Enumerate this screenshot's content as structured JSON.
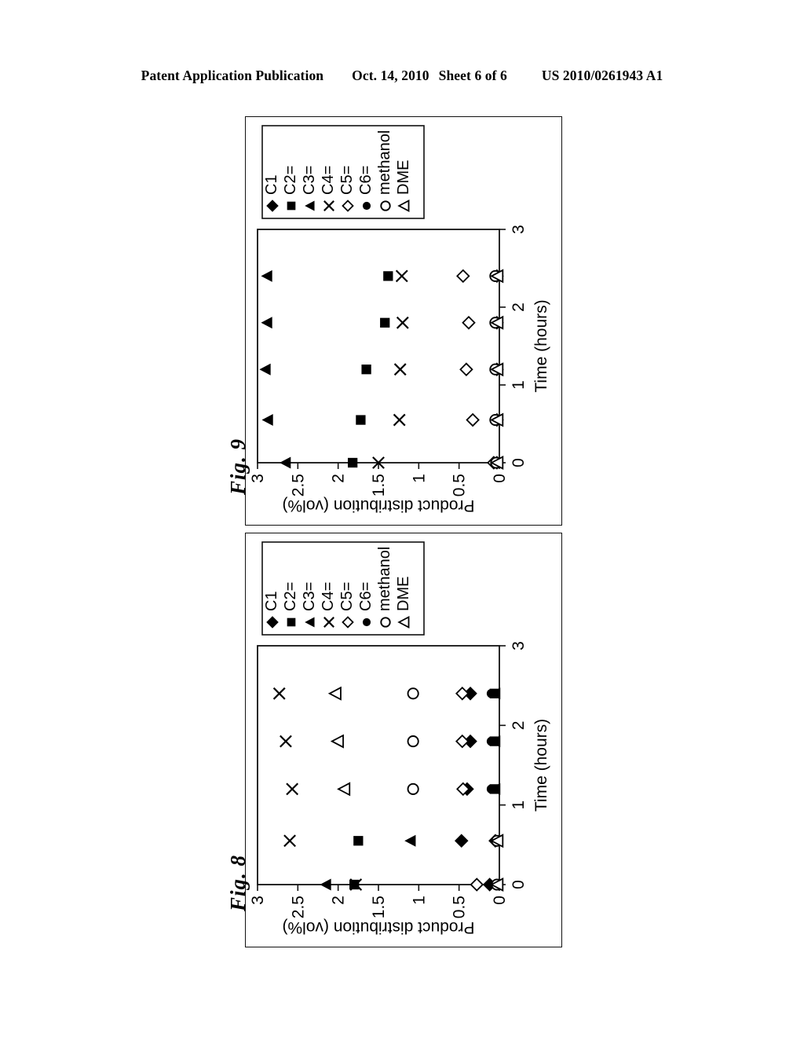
{
  "header": {
    "publication": "Patent Application Publication",
    "date": "Oct. 14, 2010",
    "sheet": "Sheet 6 of 6",
    "doc_number": "US 2010/0261943 A1"
  },
  "figures": [
    {
      "caption": "Fig. 9",
      "chart_ref": 0
    },
    {
      "caption": "Fig. 8",
      "chart_ref": 1
    }
  ],
  "legend_entries": [
    {
      "label": "C1",
      "marker": "filled-diamond"
    },
    {
      "label": "C2=",
      "marker": "filled-square"
    },
    {
      "label": "C3=",
      "marker": "filled-triangle"
    },
    {
      "label": "C4=",
      "marker": "cross-x"
    },
    {
      "label": "C5=",
      "marker": "open-diamond"
    },
    {
      "label": "C6=",
      "marker": "filled-circle"
    },
    {
      "label": "methanol",
      "marker": "open-circle"
    },
    {
      "label": "DME",
      "marker": "open-triangle"
    }
  ],
  "chart_data": [
    {
      "type": "scatter",
      "title": "Fig. 9",
      "xlabel": "Time (hours)",
      "ylabel": "Product distribution (vol%)",
      "xlim": [
        0,
        3
      ],
      "ylim": [
        0,
        3
      ],
      "xticks": [
        "0",
        "1",
        "2",
        "3"
      ],
      "yticks": [
        "0",
        "0.5",
        "1",
        "1.5",
        "2",
        "2.5",
        "3"
      ],
      "grid": false,
      "legend_position": "outside-right",
      "x": [
        0,
        0.55,
        1.2,
        1.8,
        2.4
      ],
      "series": [
        {
          "name": "C1",
          "marker": "filled-diamond",
          "values": [
            0.03,
            0.03,
            0.03,
            0.03,
            0.03
          ]
        },
        {
          "name": "C2=",
          "marker": "filled-square",
          "values": [
            1.82,
            1.72,
            1.65,
            1.42,
            1.38
          ]
        },
        {
          "name": "C3=",
          "marker": "filled-triangle",
          "values": [
            2.65,
            2.87,
            2.9,
            2.88,
            2.88
          ]
        },
        {
          "name": "C4=",
          "marker": "cross-x",
          "values": [
            1.5,
            1.24,
            1.23,
            1.2,
            1.21
          ]
        },
        {
          "name": "C5=",
          "marker": "open-diamond",
          "values": [
            0.07,
            0.33,
            0.41,
            0.38,
            0.45
          ]
        },
        {
          "name": "C6=",
          "marker": "filled-circle",
          "values": [
            0.05,
            0.06,
            0.06,
            0.06,
            0.06
          ]
        },
        {
          "name": "methanol",
          "marker": "open-circle",
          "values": [
            0.04,
            0.05,
            0.05,
            0.05,
            0.05
          ]
        },
        {
          "name": "DME",
          "marker": "open-triangle",
          "values": [
            0.02,
            0.02,
            0.02,
            0.02,
            0.02
          ]
        }
      ]
    },
    {
      "type": "scatter",
      "title": "Fig. 8",
      "xlabel": "Time (hours)",
      "ylabel": "Product distribution (vol%)",
      "xlim": [
        0,
        3
      ],
      "ylim": [
        0,
        3
      ],
      "xticks": [
        "0",
        "1",
        "2",
        "3"
      ],
      "yticks": [
        "0",
        "0.5",
        "1",
        "1.5",
        "2",
        "2.5",
        "3"
      ],
      "grid": false,
      "legend_position": "outside-right",
      "x": [
        0,
        0.55,
        1.2,
        1.8,
        2.4
      ],
      "series": [
        {
          "name": "C1",
          "marker": "filled-diamond",
          "values": [
            0.12,
            0.47,
            0.4,
            0.36,
            0.36
          ]
        },
        {
          "name": "C2=",
          "marker": "filled-square",
          "values": [
            1.8,
            1.75,
            0.06,
            0.06,
            0.06
          ]
        },
        {
          "name": "C3=",
          "marker": "filled-triangle",
          "values": [
            2.15,
            1.1,
            0.05,
            0.05,
            0.05
          ]
        },
        {
          "name": "C4=",
          "marker": "cross-x",
          "values": [
            1.78,
            2.6,
            2.57,
            2.65,
            2.73
          ]
        },
        {
          "name": "C5=",
          "marker": "open-diamond",
          "values": [
            0.28,
            0.05,
            0.45,
            0.46,
            0.46
          ]
        },
        {
          "name": "C6=",
          "marker": "filled-circle",
          "values": [
            0.05,
            0.05,
            0.1,
            0.1,
            0.1
          ]
        },
        {
          "name": "methanol",
          "marker": "open-circle",
          "values": [
            0.03,
            0.03,
            1.07,
            1.07,
            1.07
          ]
        },
        {
          "name": "DME",
          "marker": "open-triangle",
          "values": [
            0.02,
            0.02,
            1.92,
            2.0,
            2.03
          ]
        }
      ]
    }
  ]
}
